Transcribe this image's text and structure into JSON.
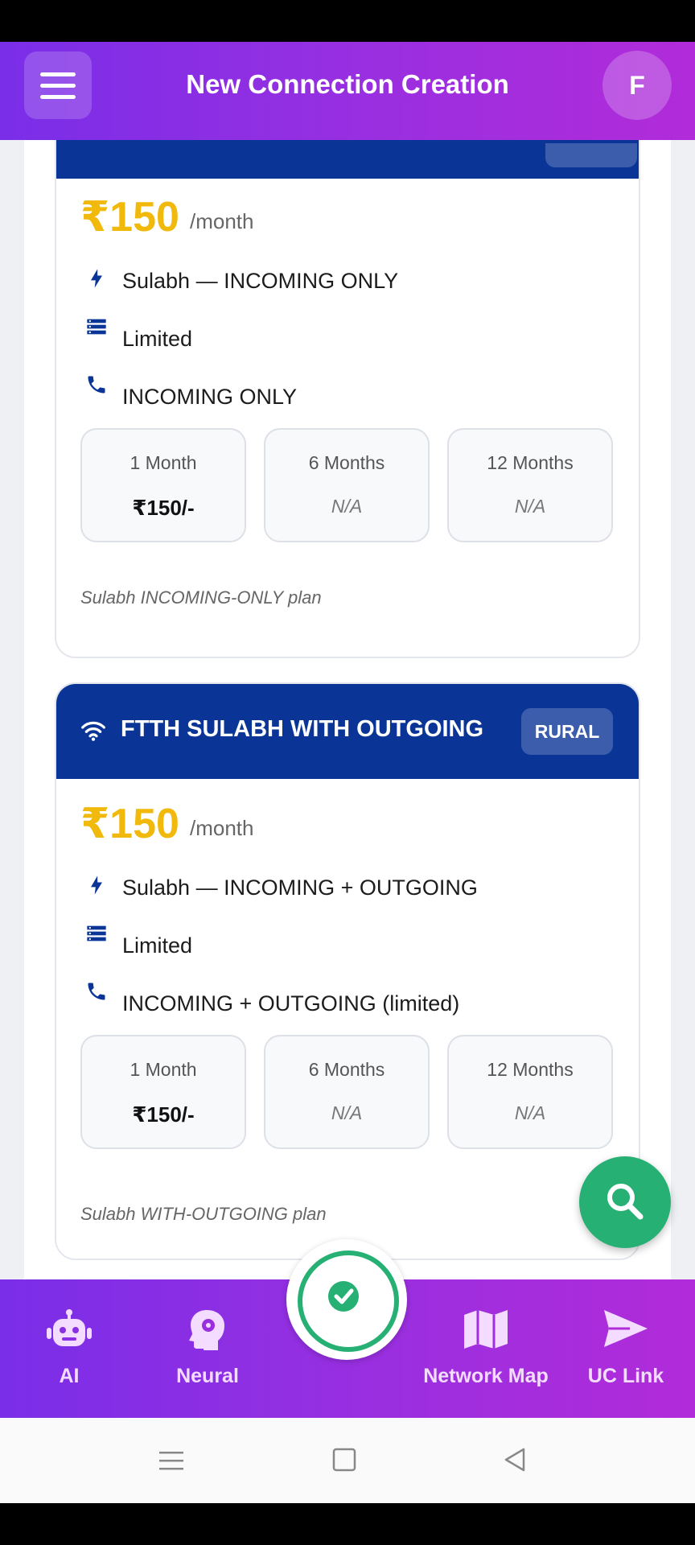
{
  "app_bar": {
    "title": "New Connection Creation",
    "avatar_letter": "F"
  },
  "plans": [
    {
      "title": "",
      "badge": "",
      "price": "₹150",
      "period": "/month",
      "features": [
        {
          "icon": "lightning-icon",
          "text": "Sulabh — INCOMING ONLY"
        },
        {
          "icon": "list-icon",
          "text": "Limited"
        },
        {
          "icon": "phone-icon",
          "text": "INCOMING ONLY"
        }
      ],
      "durations": [
        {
          "label": "1 Month",
          "price": "₹150/-"
        },
        {
          "label": "6 Months",
          "price": "N/A"
        },
        {
          "label": "12 Months",
          "price": "N/A"
        }
      ],
      "note": "Sulabh INCOMING-ONLY plan"
    },
    {
      "title": "FTTH SULABH WITH OUTGOING",
      "badge": "RURAL",
      "price": "₹150",
      "period": "/month",
      "features": [
        {
          "icon": "lightning-icon",
          "text": "Sulabh — INCOMING + OUTGOING"
        },
        {
          "icon": "list-icon",
          "text": "Limited"
        },
        {
          "icon": "phone-icon",
          "text": "INCOMING + OUTGOING (limited)"
        }
      ],
      "durations": [
        {
          "label": "1 Month",
          "price": "₹150/-"
        },
        {
          "label": "6 Months",
          "price": "N/A"
        },
        {
          "label": "12 Months",
          "price": "N/A"
        }
      ],
      "note": "Sulabh WITH-OUTGOING plan"
    }
  ],
  "bottom_nav": [
    {
      "icon": "robot-icon",
      "label": "AI"
    },
    {
      "icon": "brain-icon",
      "label": "Neural"
    },
    {
      "icon": "map-icon",
      "label": "Network Map"
    },
    {
      "icon": "send-icon",
      "label": "UC Link"
    }
  ],
  "colors": {
    "header_gradient": [
      "#7a2ee8",
      "#b12bd9"
    ],
    "card_header": "#0a3597",
    "price": "#f0b90b",
    "accent_green": "#26b074"
  }
}
